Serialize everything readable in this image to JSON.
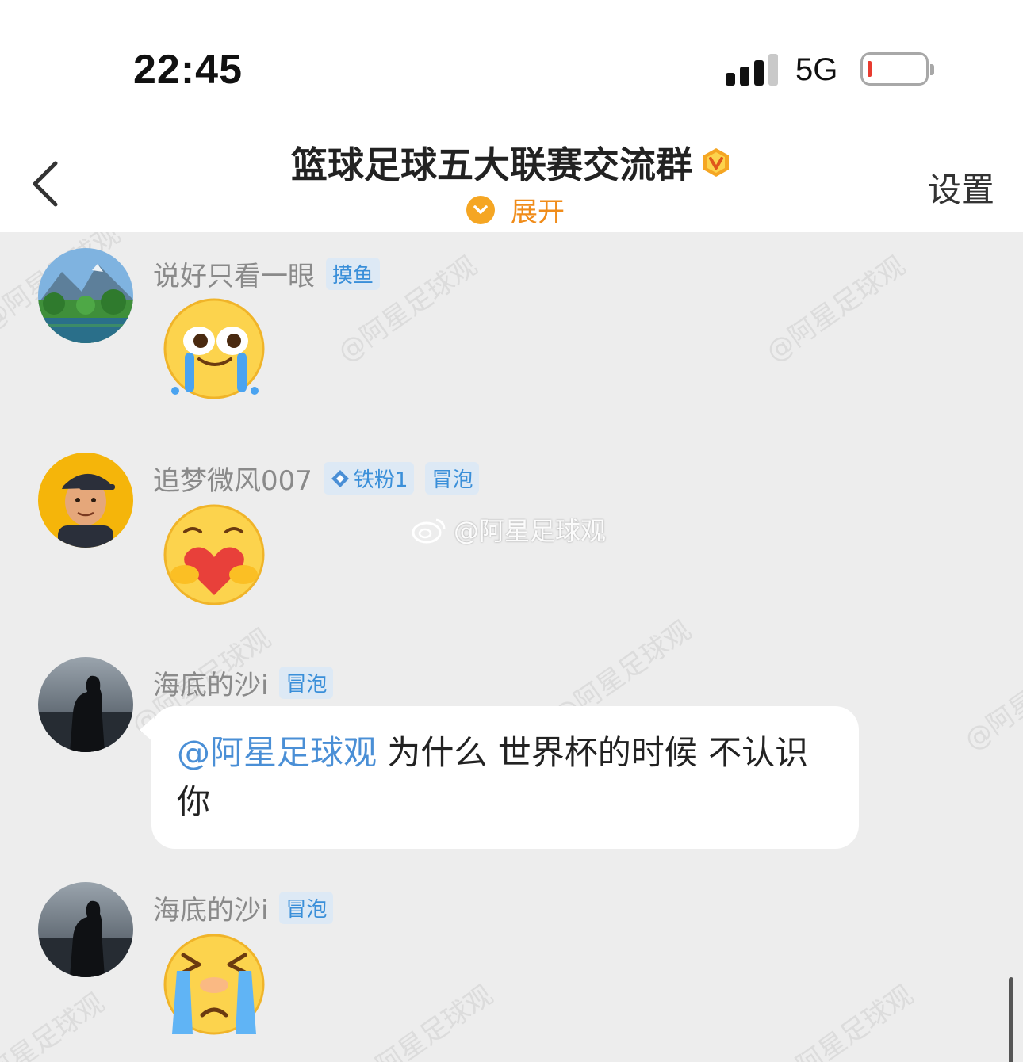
{
  "status_bar": {
    "time": "22:45",
    "network": "5G",
    "battery_level": 0.05
  },
  "nav": {
    "back_icon": "chevron-left-icon",
    "title": "篮球足球五大联赛交流群",
    "verified_icon": "v-badge-icon",
    "expand_label": "展开",
    "settings_label": "设置"
  },
  "messages": [
    {
      "sender": "说好只看一眼",
      "tags": [
        "摸鱼"
      ],
      "type": "sticker",
      "sticker": "crying-laugh-emoji"
    },
    {
      "sender": "追梦微风007",
      "tags": [
        "铁粉1",
        "冒泡"
      ],
      "type": "sticker",
      "sticker": "heart-hug-emoji"
    },
    {
      "sender": "海底的沙i",
      "tags": [
        "冒泡"
      ],
      "type": "text",
      "mention": "@阿星足球观",
      "text": " 为什么 世界杯的时候 不认识你"
    },
    {
      "sender": "海底的沙i",
      "tags": [
        "冒泡"
      ],
      "type": "sticker",
      "sticker": "loud-crying-emoji"
    }
  ],
  "watermark_text": "@阿星足球观",
  "colors": {
    "accent_orange": "#f5a623",
    "mention_blue": "#4a8fd6",
    "tag_blue": "#3a8fd9",
    "chat_bg": "#ededed"
  }
}
